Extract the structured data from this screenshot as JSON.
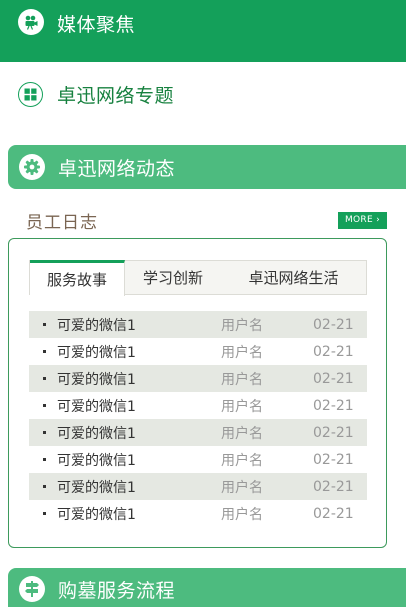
{
  "sections": {
    "media": {
      "title": "媒体聚焦",
      "icon": "video-camera-icon"
    },
    "topics": {
      "title": "卓迅网络专题",
      "icon": "grid-icon"
    },
    "dynamic": {
      "title": "卓迅网络动态",
      "icon": "gear-icon"
    },
    "funeral": {
      "title": "购墓服务流程",
      "icon": "signpost-icon"
    }
  },
  "staff_log": {
    "title": "员工日志",
    "more_label": "MORE",
    "more_icon": "chevron-right-icon",
    "tabs": [
      {
        "label": "服务故事",
        "active": true
      },
      {
        "label": "学习创新",
        "active": false
      },
      {
        "label": "卓迅网络生活",
        "active": false
      }
    ],
    "rows": [
      {
        "title": "可爱的微信1",
        "user": "用户名",
        "date": "02-21"
      },
      {
        "title": "可爱的微信1",
        "user": "用户名",
        "date": "02-21"
      },
      {
        "title": "可爱的微信1",
        "user": "用户名",
        "date": "02-21"
      },
      {
        "title": "可爱的微信1",
        "user": "用户名",
        "date": "02-21"
      },
      {
        "title": "可爱的微信1",
        "user": "用户名",
        "date": "02-21"
      },
      {
        "title": "可爱的微信1",
        "user": "用户名",
        "date": "02-21"
      },
      {
        "title": "可爱的微信1",
        "user": "用户名",
        "date": "02-21"
      },
      {
        "title": "可爱的微信1",
        "user": "用户名",
        "date": "02-21"
      }
    ]
  },
  "colors": {
    "brand_green": "#14a05a",
    "light_green": "#4dbb7f",
    "row_stripe": "#e5e8e2"
  }
}
